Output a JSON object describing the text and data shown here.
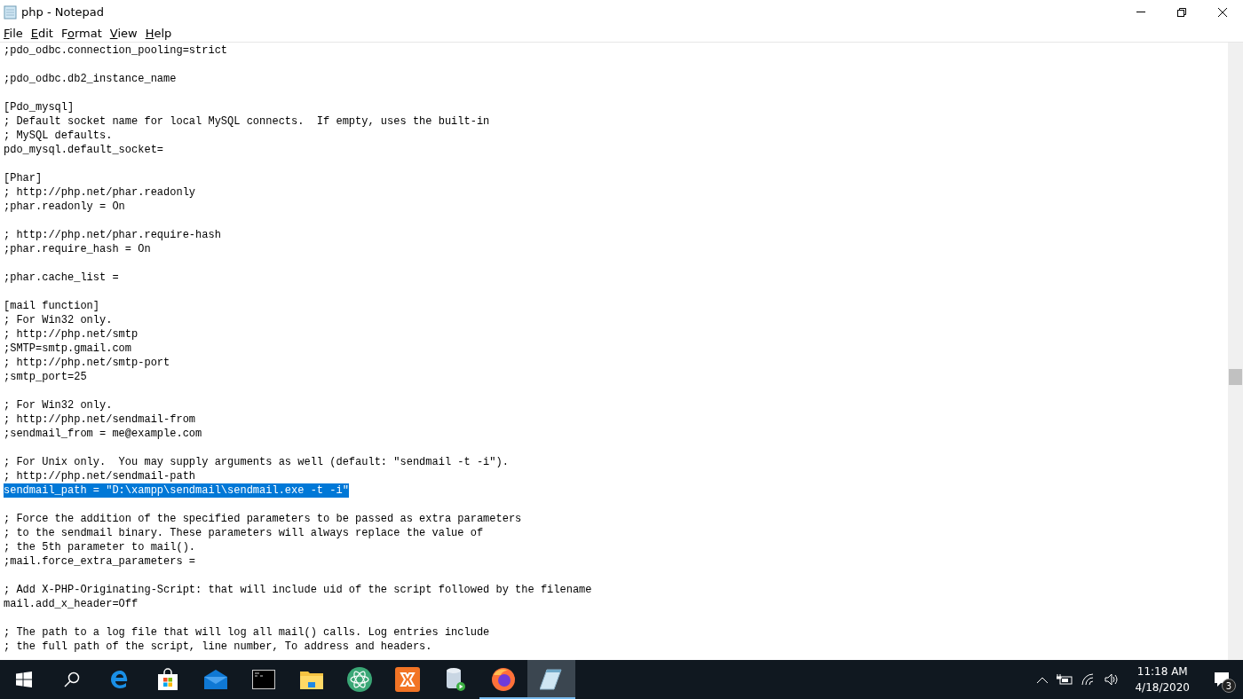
{
  "window": {
    "title": "php - Notepad"
  },
  "menu": [
    {
      "parts": [
        {
          "text": "F",
          "underlined": true
        },
        {
          "text": "ile",
          "underlined": false
        }
      ]
    },
    {
      "parts": [
        {
          "text": "E",
          "underlined": true
        },
        {
          "text": "dit",
          "underlined": false
        }
      ]
    },
    {
      "parts": [
        {
          "text": "F",
          "underlined": false
        },
        {
          "text": "o",
          "underlined": true
        },
        {
          "text": "rmat",
          "underlined": false
        }
      ]
    },
    {
      "parts": [
        {
          "text": "V",
          "underlined": true
        },
        {
          "text": "iew",
          "underlined": false
        }
      ]
    },
    {
      "parts": [
        {
          "text": "H",
          "underlined": true
        },
        {
          "text": "elp",
          "underlined": false
        }
      ]
    }
  ],
  "editor": {
    "blocks": [
      [
        {
          "text": ";pdo_odbc.connection_pooling=strict",
          "selected": false
        }
      ],
      [
        {
          "text": ";pdo_odbc.db2_instance_name",
          "selected": false
        }
      ],
      [
        {
          "text": "[Pdo_mysql]",
          "selected": false
        },
        {
          "text": "; Default socket name for local MySQL connects.  If empty, uses the built-in",
          "selected": false
        },
        {
          "text": "; MySQL defaults.",
          "selected": false
        },
        {
          "text": "pdo_mysql.default_socket=",
          "selected": false
        }
      ],
      [
        {
          "text": "[Phar]",
          "selected": false
        },
        {
          "text": "; http://php.net/phar.readonly",
          "selected": false
        },
        {
          "text": ";phar.readonly = On",
          "selected": false
        }
      ],
      [
        {
          "text": "; http://php.net/phar.require-hash",
          "selected": false
        },
        {
          "text": ";phar.require_hash = On",
          "selected": false
        }
      ],
      [
        {
          "text": ";phar.cache_list =",
          "selected": false
        }
      ],
      [
        {
          "text": "[mail function]",
          "selected": false
        },
        {
          "text": "; For Win32 only.",
          "selected": false
        },
        {
          "text": "; http://php.net/smtp",
          "selected": false
        },
        {
          "text": ";SMTP=smtp.gmail.com",
          "selected": false
        },
        {
          "text": "; http://php.net/smtp-port",
          "selected": false
        },
        {
          "text": ";smtp_port=25",
          "selected": false
        }
      ],
      [
        {
          "text": "; For Win32 only.",
          "selected": false
        },
        {
          "text": "; http://php.net/sendmail-from",
          "selected": false
        },
        {
          "text": ";sendmail_from = me@example.com",
          "selected": false
        }
      ],
      [
        {
          "text": "; For Unix only.  You may supply arguments as well (default: \"sendmail -t -i\").",
          "selected": false
        },
        {
          "text": "; http://php.net/sendmail-path",
          "selected": false
        },
        {
          "text": "sendmail_path = \"D:\\xampp\\sendmail\\sendmail.exe -t -i\"",
          "selected": true
        }
      ],
      [
        {
          "text": "; Force the addition of the specified parameters to be passed as extra parameters",
          "selected": false
        },
        {
          "text": "; to the sendmail binary. These parameters will always replace the value of",
          "selected": false
        },
        {
          "text": "; the 5th parameter to mail().",
          "selected": false
        },
        {
          "text": ";mail.force_extra_parameters =",
          "selected": false
        }
      ],
      [
        {
          "text": "; Add X-PHP-Originating-Script: that will include uid of the script followed by the filename",
          "selected": false
        },
        {
          "text": "mail.add_x_header=Off",
          "selected": false
        }
      ],
      [
        {
          "text": "; The path to a log file that will log all mail() calls. Log entries include",
          "selected": false
        },
        {
          "text": "; the full path of the script, line number, To address and headers.",
          "selected": false
        }
      ]
    ]
  },
  "taskbar": {
    "apps": [
      {
        "kind": "start",
        "running": false,
        "selected": false
      },
      {
        "kind": "search",
        "running": false,
        "selected": false
      },
      {
        "kind": "edge",
        "running": false,
        "selected": false
      },
      {
        "kind": "store",
        "running": false,
        "selected": false
      },
      {
        "kind": "mail",
        "running": false,
        "selected": false
      },
      {
        "kind": "terminal",
        "running": false,
        "selected": false
      },
      {
        "kind": "folder",
        "running": false,
        "selected": false
      },
      {
        "kind": "atom",
        "running": false,
        "selected": false
      },
      {
        "kind": "xampp",
        "running": false,
        "selected": false
      },
      {
        "kind": "database",
        "running": false,
        "selected": false
      },
      {
        "kind": "firefox",
        "running": true,
        "selected": false
      },
      {
        "kind": "notepad",
        "running": true,
        "selected": true
      }
    ],
    "time": "11:18 AM",
    "date": "4/18/2020",
    "notifications": "3"
  }
}
